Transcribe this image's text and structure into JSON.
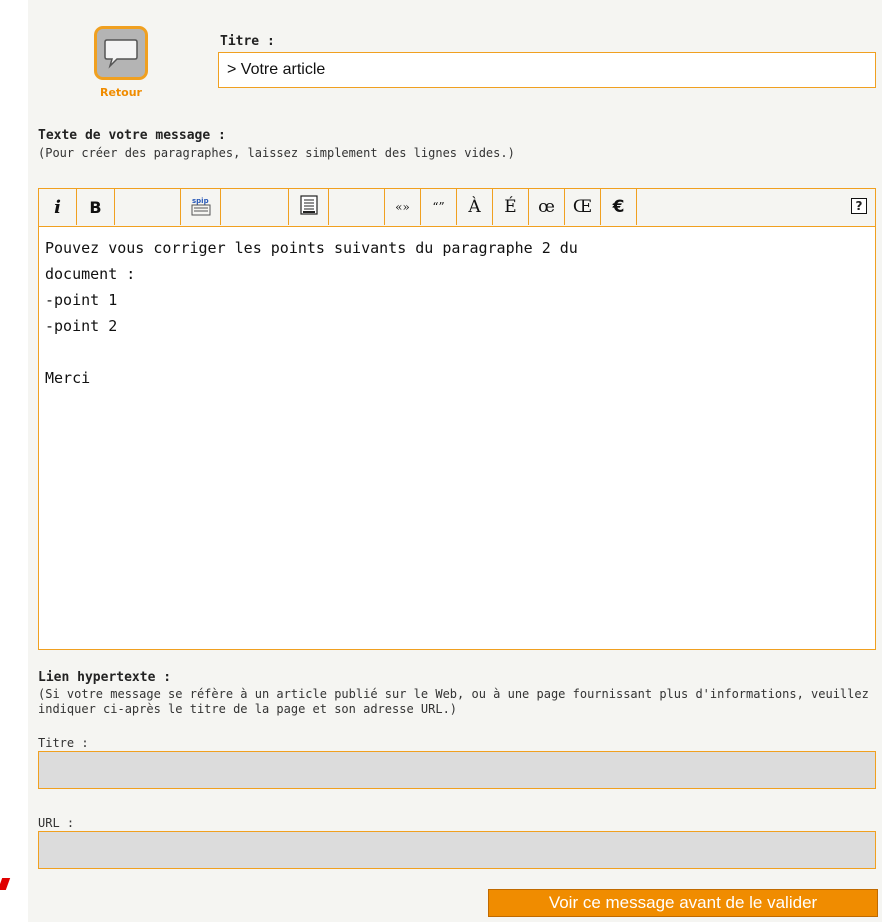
{
  "retour": {
    "label": "Retour",
    "icon": "speech-bubble-icon"
  },
  "titre": {
    "label": "Titre :",
    "value": "> Votre article"
  },
  "texte": {
    "title": "Texte de votre message :",
    "hint": "(Pour créer des paragraphes, laissez simplement des lignes vides.)",
    "body": "Pouvez vous corriger les points suivants du paragraphe 2 du\ndocument :\n-point 1\n-point 2\n\nMerci"
  },
  "toolbar": {
    "italic": "i",
    "bold": "B",
    "spip_icon": "spip-link-icon",
    "frame_icon": "frame-icon",
    "guillemets": "«»",
    "quotes": "“”",
    "a_grave": "À",
    "e_acute": "É",
    "oe": "œ",
    "OE": "Œ",
    "euro": "€",
    "help": "?"
  },
  "lien": {
    "title": "Lien hypertexte :",
    "hint": "(Si votre message se réfère à un article publié sur le Web, ou à une page fournissant plus d'informations, veuillez indiquer ci-après le titre de la page et son adresse URL.)",
    "titre_label": "Titre :",
    "titre_value": "",
    "url_label": "URL :",
    "url_value": ""
  },
  "submit": {
    "label": "Voir ce message avant de le valider"
  },
  "colors": {
    "accent": "#f0a020",
    "button": "#f08c00",
    "panel": "#f5f5f2",
    "field_disabled": "#dcdcdc"
  }
}
